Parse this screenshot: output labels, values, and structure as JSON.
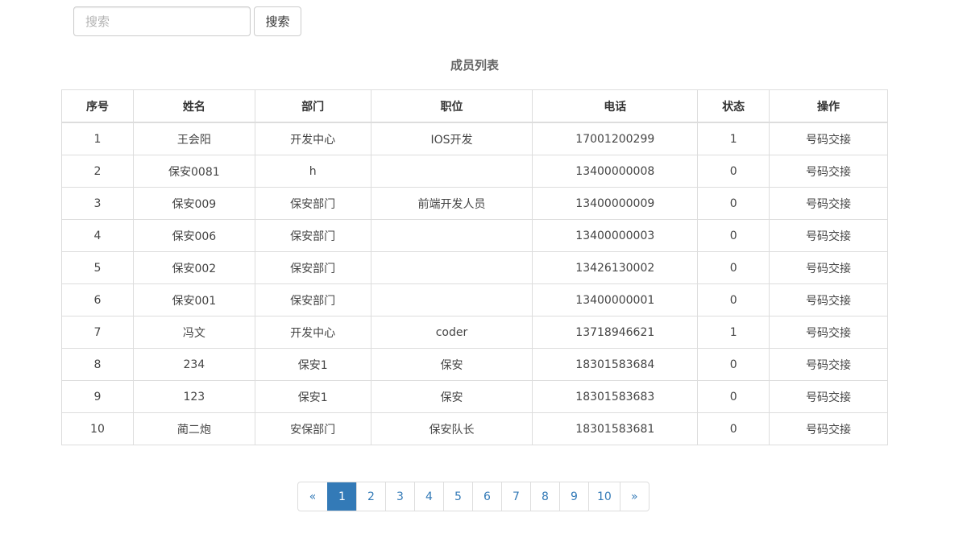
{
  "search": {
    "placeholder": "搜索",
    "button_label": "搜索"
  },
  "table": {
    "title": "成员列表",
    "headers": [
      "序号",
      "姓名",
      "部门",
      "职位",
      "电话",
      "状态",
      "操作"
    ],
    "rows": [
      [
        "1",
        "王会阳",
        "开发中心",
        "IOS开发",
        "17001200299",
        "1",
        "号码交接"
      ],
      [
        "2",
        "保安0081",
        "h",
        "",
        "13400000008",
        "0",
        "号码交接"
      ],
      [
        "3",
        "保安009",
        "保安部门",
        "前端开发人员",
        "13400000009",
        "0",
        "号码交接"
      ],
      [
        "4",
        "保安006",
        "保安部门",
        "",
        "13400000003",
        "0",
        "号码交接"
      ],
      [
        "5",
        "保安002",
        "保安部门",
        "",
        "13426130002",
        "0",
        "号码交接"
      ],
      [
        "6",
        "保安001",
        "保安部门",
        "",
        "13400000001",
        "0",
        "号码交接"
      ],
      [
        "7",
        "冯文",
        "开发中心",
        "coder",
        "13718946621",
        "1",
        "号码交接"
      ],
      [
        "8",
        "234",
        "保安1",
        "保安",
        "18301583684",
        "0",
        "号码交接"
      ],
      [
        "9",
        "123",
        "保安1",
        "保安",
        "18301583683",
        "0",
        "号码交接"
      ],
      [
        "10",
        "蔺二炮",
        "安保部门",
        "保安队长",
        "18301583681",
        "0",
        "号码交接"
      ]
    ]
  },
  "pagination": {
    "prev_label": "«",
    "next_label": "»",
    "pages": [
      "1",
      "2",
      "3",
      "4",
      "5",
      "6",
      "7",
      "8",
      "9",
      "10"
    ],
    "active_page": "1",
    "accent_color": "#337ab7"
  }
}
